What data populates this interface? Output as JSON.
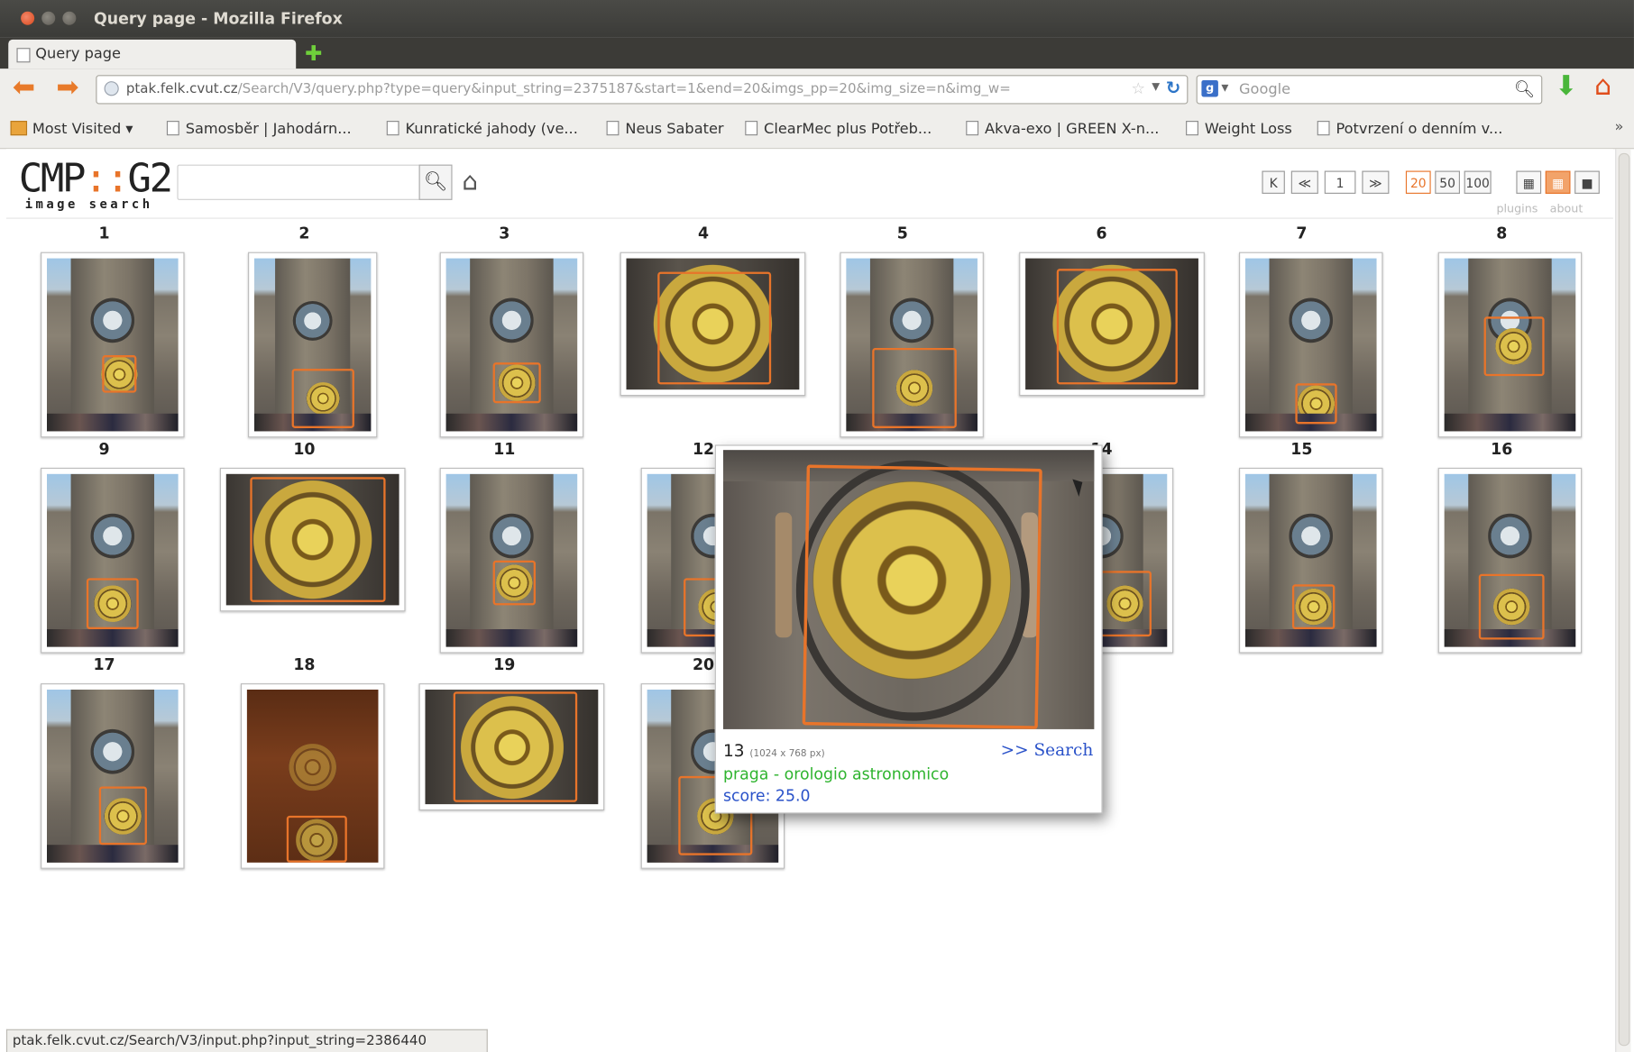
{
  "window": {
    "title": "Query page - Mozilla Firefox"
  },
  "tab": {
    "label": "Query page",
    "new_tab_icon": "plus-icon"
  },
  "nav": {
    "url_host": "ptak.felk.cvut.cz",
    "url_rest": "/Search/V3/query.php?type=query&input_string=2375187&start=1&end=20&imgs_pp=20&img_size=n&img_w=",
    "search_engine": "Google"
  },
  "bookmarks": [
    "Most Visited ▾",
    "Samosběr | Jahodárn...",
    "Kunratické jahody (ve...",
    "Neus Sabater",
    "ClearMec plus Potřeb...",
    "Akva-exo | GREEN X-n...",
    "Weight Loss",
    "Potvrzení o denním v..."
  ],
  "bookmarks_more": "»",
  "logo": {
    "main_left": "CMP",
    "main_dots": "::",
    "main_right": "G2",
    "sub": "image search"
  },
  "pager": {
    "first": "K",
    "prev": "≪",
    "page": "1",
    "next": "≫",
    "per_page": [
      "20",
      "50",
      "100"
    ],
    "selected_per_page": "20",
    "links": "plugins about"
  },
  "results": [
    {
      "n": "1"
    },
    {
      "n": "2"
    },
    {
      "n": "3"
    },
    {
      "n": "4"
    },
    {
      "n": "5"
    },
    {
      "n": "6"
    },
    {
      "n": "7"
    },
    {
      "n": "8"
    },
    {
      "n": "9"
    },
    {
      "n": "10"
    },
    {
      "n": "11"
    },
    {
      "n": "12"
    },
    {
      "n": "14"
    },
    {
      "n": "15"
    },
    {
      "n": "16"
    },
    {
      "n": "17"
    },
    {
      "n": "18"
    },
    {
      "n": "19"
    },
    {
      "n": "20"
    }
  ],
  "popup": {
    "number": "13",
    "dimensions": "(1024 x 768 px)",
    "search_link": ">> Search",
    "title": "praga - orologio astronomico",
    "score": "score: 25.0"
  },
  "status": {
    "text": "ptak.felk.cvut.cz/Search/V3/input.php?input_string=2386440"
  },
  "colors": {
    "accent": "#e8742a",
    "link": "#2a52c9",
    "caption_green": "#2fb42f"
  }
}
